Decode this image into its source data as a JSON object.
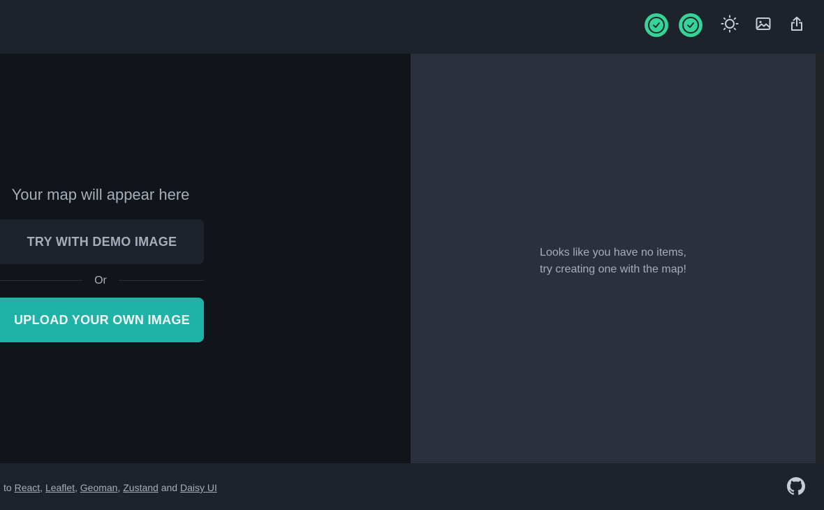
{
  "header": {
    "status_icons": [
      "check-circle-icon",
      "check-circle-icon"
    ],
    "theme_icon": "sun-icon",
    "image_icon": "image-icon",
    "export_icon": "share-upload-icon"
  },
  "map_panel": {
    "title": "Your map will appear here",
    "demo_button": "TRY WITH DEMO IMAGE",
    "or_label": "Or",
    "upload_button": "UPLOAD YOUR OWN IMAGE"
  },
  "items_panel": {
    "empty_line1": "Looks like you have no items,",
    "empty_line2": "try creating one with the map!"
  },
  "footer": {
    "prefix": "to",
    "links": [
      "React",
      "Leaflet",
      "Geoman",
      "Zustand",
      "Daisy UI"
    ],
    "sep1": ",",
    "sep2": ",",
    "sep3": ",",
    "and": "and",
    "github_icon": "github-icon"
  },
  "colors": {
    "accent": "#1fb2a6",
    "success": "#36d399",
    "panel_dark": "#111519",
    "panel_mid": "#2a303c",
    "chrome": "#1d232a"
  }
}
